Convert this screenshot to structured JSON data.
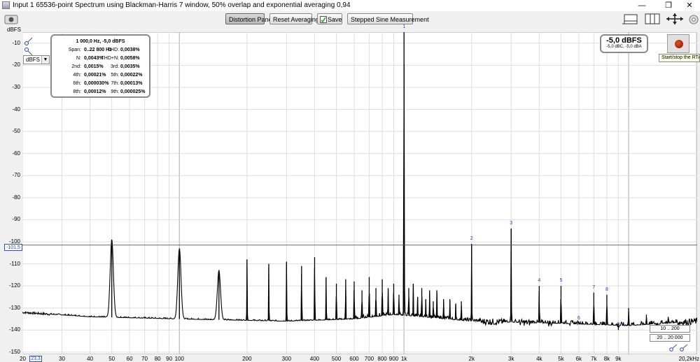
{
  "window": {
    "title": "Input 1 65536-point Spectrum using Blackman-Harris 7 window, 50% overlap and exponential averaging 0,94",
    "minimize": "—",
    "maximize": "❐",
    "close": "✕"
  },
  "toolbar": {
    "distortion_panel": "Distortion Panel",
    "reset_averaging": "Reset Averaging",
    "save": "Save",
    "stepped_sine": "Stepped Sine Measurement"
  },
  "stats": {
    "header": "1 000,0 Hz, -5,0 dBFS",
    "rows": [
      {
        "l1": "Span:",
        "v1": "0..22 800 Hz",
        "l2": "THD:",
        "v2": "0,0038%"
      },
      {
        "l1": "N:",
        "v1": "0,0043%",
        "l2": "THD+N:",
        "v2": "0,0058%"
      },
      {
        "l1": "2nd:",
        "v1": "0,0015%",
        "l2": "3rd:",
        "v2": "0,0035%"
      },
      {
        "l1": "4th:",
        "v1": "0,00021%",
        "l2": "5th:",
        "v2": "0,00022%"
      },
      {
        "l1": "6th:",
        "v1": "0,000030%",
        "l2": "7th:",
        "v2": "0,00013%"
      },
      {
        "l1": "8th:",
        "v1": "0,00012%",
        "l2": "9th:",
        "v2": "0,000025%"
      }
    ]
  },
  "level": {
    "main": "-5,0 dBFS",
    "sub": "-5,0 dBC, -5,0 dBA"
  },
  "rta_tooltip": "Start/stop the RTA",
  "unit_select": "dBFS",
  "cursor_value": "-101,5",
  "xmin_value": "23,3",
  "ranges": {
    "r1": "10 .. 200",
    "r2": "20 .. 20 000"
  },
  "colors": {
    "trace": "#000000",
    "grid_major": "#b8b8b8",
    "grid_minor": "#dedede",
    "cursor": "#3050d0",
    "harmonic_label": "#1c3fd0"
  },
  "chart_data": {
    "type": "line",
    "title": "",
    "ylabel": "dBFS",
    "xlabel": "",
    "x_scale": "log",
    "xlim": [
      20,
      20200
    ],
    "ylim": [
      -151,
      -5
    ],
    "x_ticks": [
      {
        "v": 20,
        "t": "20"
      },
      {
        "v": 30,
        "t": "30"
      },
      {
        "v": 40,
        "t": "40"
      },
      {
        "v": 50,
        "t": "50"
      },
      {
        "v": 60,
        "t": "60"
      },
      {
        "v": 70,
        "t": "70"
      },
      {
        "v": 80,
        "t": "80"
      },
      {
        "v": 90,
        "t": "90"
      },
      {
        "v": 100,
        "t": "100"
      },
      {
        "v": 200,
        "t": "200"
      },
      {
        "v": 300,
        "t": "300"
      },
      {
        "v": 400,
        "t": "400"
      },
      {
        "v": 500,
        "t": "500"
      },
      {
        "v": 600,
        "t": "600"
      },
      {
        "v": 700,
        "t": "700"
      },
      {
        "v": 800,
        "t": "800"
      },
      {
        "v": 900,
        "t": "900"
      },
      {
        "v": 1000,
        "t": "1k"
      },
      {
        "v": 2000,
        "t": "2k"
      },
      {
        "v": 3000,
        "t": "3k"
      },
      {
        "v": 4000,
        "t": "4k"
      },
      {
        "v": 5000,
        "t": "5k"
      },
      {
        "v": 6000,
        "t": "6k"
      },
      {
        "v": 7000,
        "t": "7k"
      },
      {
        "v": 8000,
        "t": "8k"
      },
      {
        "v": 9000,
        "t": "9k"
      },
      {
        "v": 20200,
        "t": "20,2kHz"
      }
    ],
    "y_ticks": [
      -10,
      -20,
      -30,
      -40,
      -50,
      -60,
      -70,
      -80,
      -90,
      -100,
      -110,
      -120,
      -130,
      -140,
      -150
    ],
    "noise_floor": [
      {
        "f": 20,
        "db": -132
      },
      {
        "f": 40,
        "db": -134
      },
      {
        "f": 100,
        "db": -135
      },
      {
        "f": 300,
        "db": -136
      },
      {
        "f": 600,
        "db": -135
      },
      {
        "f": 900,
        "db": -133
      },
      {
        "f": 1200,
        "db": -134
      },
      {
        "f": 2000,
        "db": -136
      },
      {
        "f": 5000,
        "db": -137
      },
      {
        "f": 10000,
        "db": -138
      },
      {
        "f": 20200,
        "db": -136
      }
    ],
    "peaks": [
      {
        "f": 50,
        "db": -99
      },
      {
        "f": 100,
        "db": -103
      },
      {
        "f": 150,
        "db": -113
      },
      {
        "f": 200,
        "db": -108
      },
      {
        "f": 250,
        "db": -110
      },
      {
        "f": 300,
        "db": -109
      },
      {
        "f": 350,
        "db": -111
      },
      {
        "f": 400,
        "db": -107
      },
      {
        "f": 450,
        "db": -116
      },
      {
        "f": 500,
        "db": -119
      },
      {
        "f": 550,
        "db": -117
      },
      {
        "f": 600,
        "db": -118
      },
      {
        "f": 650,
        "db": -122
      },
      {
        "f": 700,
        "db": -116
      },
      {
        "f": 750,
        "db": -121
      },
      {
        "f": 800,
        "db": -117
      },
      {
        "f": 850,
        "db": -121
      },
      {
        "f": 900,
        "db": -119
      },
      {
        "f": 950,
        "db": -124
      },
      {
        "f": 1000,
        "db": -5
      },
      {
        "f": 1050,
        "db": -121
      },
      {
        "f": 1100,
        "db": -119
      },
      {
        "f": 1150,
        "db": -125
      },
      {
        "f": 1200,
        "db": -121
      },
      {
        "f": 1250,
        "db": -126
      },
      {
        "f": 1300,
        "db": -122
      },
      {
        "f": 1350,
        "db": -127
      },
      {
        "f": 1400,
        "db": -122
      },
      {
        "f": 1500,
        "db": -126
      },
      {
        "f": 1600,
        "db": -126
      },
      {
        "f": 1700,
        "db": -128
      },
      {
        "f": 1800,
        "db": -127
      },
      {
        "f": 2000,
        "db": -101
      },
      {
        "f": 3000,
        "db": -94
      },
      {
        "f": 4000,
        "db": -120
      },
      {
        "f": 5000,
        "db": -120
      },
      {
        "f": 6000,
        "db": -137
      },
      {
        "f": 7000,
        "db": -123
      },
      {
        "f": 8000,
        "db": -124
      },
      {
        "f": 9000,
        "db": -140
      },
      {
        "f": 10000,
        "db": -130
      },
      {
        "f": 12000,
        "db": -133
      },
      {
        "f": 15000,
        "db": -134
      }
    ],
    "harmonic_labels": [
      {
        "n": "1",
        "f": 1000,
        "db": -5
      },
      {
        "n": "2",
        "f": 2000,
        "db": -101
      },
      {
        "n": "3",
        "f": 3000,
        "db": -94
      },
      {
        "n": "4",
        "f": 4000,
        "db": -120
      },
      {
        "n": "5",
        "f": 5000,
        "db": -120
      },
      {
        "n": "6",
        "f": 6000,
        "db": -137
      },
      {
        "n": "7",
        "f": 7000,
        "db": -123
      },
      {
        "n": "8",
        "f": 8000,
        "db": -124
      },
      {
        "n": "9",
        "f": 9000,
        "db": -140
      }
    ],
    "cursor_db": -101.5
  }
}
